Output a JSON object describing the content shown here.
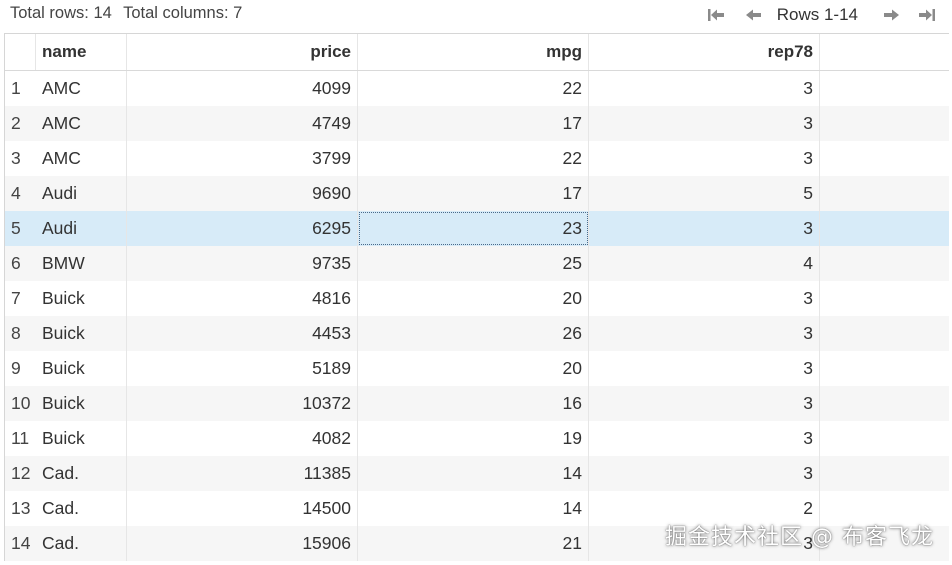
{
  "summary": {
    "total_rows": "Total rows: 14",
    "total_columns": "Total columns: 7"
  },
  "pager": {
    "rows_label": "Rows 1-14",
    "icons": [
      "first-page-icon",
      "previous-page-icon",
      "next-page-icon",
      "last-page-icon"
    ]
  },
  "table": {
    "columns": [
      "name",
      "price",
      "mpg",
      "rep78"
    ],
    "rows": [
      {
        "idx": "1",
        "name": "AMC",
        "price": "4099",
        "mpg": "22",
        "rep78": "3"
      },
      {
        "idx": "2",
        "name": "AMC",
        "price": "4749",
        "mpg": "17",
        "rep78": "3"
      },
      {
        "idx": "3",
        "name": "AMC",
        "price": "3799",
        "mpg": "22",
        "rep78": "3"
      },
      {
        "idx": "4",
        "name": "Audi",
        "price": "9690",
        "mpg": "17",
        "rep78": "5"
      },
      {
        "idx": "5",
        "name": "Audi",
        "price": "6295",
        "mpg": "23",
        "rep78": "3"
      },
      {
        "idx": "6",
        "name": "BMW",
        "price": "9735",
        "mpg": "25",
        "rep78": "4"
      },
      {
        "idx": "7",
        "name": "Buick",
        "price": "4816",
        "mpg": "20",
        "rep78": "3"
      },
      {
        "idx": "8",
        "name": "Buick",
        "price": "4453",
        "mpg": "26",
        "rep78": "3"
      },
      {
        "idx": "9",
        "name": "Buick",
        "price": "5189",
        "mpg": "20",
        "rep78": "3"
      },
      {
        "idx": "10",
        "name": "Buick",
        "price": "10372",
        "mpg": "16",
        "rep78": "3"
      },
      {
        "idx": "11",
        "name": "Buick",
        "price": "4082",
        "mpg": "19",
        "rep78": "3"
      },
      {
        "idx": "12",
        "name": "Cad.",
        "price": "11385",
        "mpg": "14",
        "rep78": "3"
      },
      {
        "idx": "13",
        "name": "Cad.",
        "price": "14500",
        "mpg": "14",
        "rep78": "2"
      },
      {
        "idx": "14",
        "name": "Cad.",
        "price": "15906",
        "mpg": "21",
        "rep78": "3"
      }
    ],
    "selected_row": 5,
    "focused_column": "mpg"
  },
  "watermark": "掘金技术社区 @ 布客飞龙",
  "colors": {
    "selected_row": "#d7ebf8",
    "striped_row": "#f6f6f6",
    "icon": "#888888"
  }
}
